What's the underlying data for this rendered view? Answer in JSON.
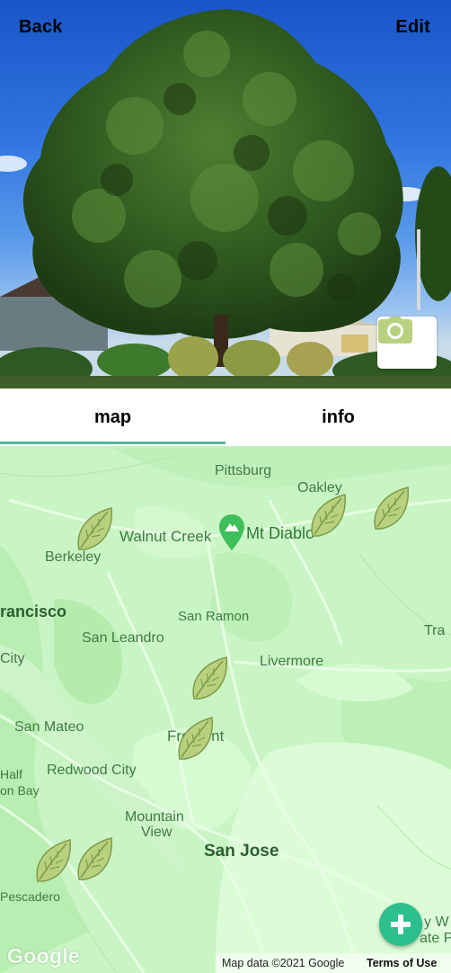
{
  "nav": {
    "back_label": "Back",
    "edit_label": "Edit"
  },
  "tabs": [
    {
      "label": "map",
      "active": true
    },
    {
      "label": "info",
      "active": false
    }
  ],
  "map": {
    "places": {
      "pittsburg": "Pittsburg",
      "oakley": "Oakley",
      "walnut_creek": "Walnut Creek",
      "mt_diablo": "Mt Diablo",
      "berkeley": "Berkeley",
      "francisco": "rancisco",
      "san_ramon": "San Ramon",
      "san_leandro": "San Leandro",
      "tra": "Tra",
      "city": "City",
      "livermore": "Livermore",
      "san_mateo": "San Mateo",
      "fremont": "Fremont",
      "half": "Half",
      "moon_bay": "on Bay",
      "redwood_city": "Redwood City",
      "mountain": "Mountain",
      "view": "View",
      "san_jose": "San Jose",
      "pescadero": "Pescadero",
      "right_edge_1": "y W",
      "right_edge_2": "ate P"
    },
    "tree_pin_count": 7,
    "attribution": {
      "logo": "Google",
      "map_data": "Map data ©2021 Google",
      "terms": "Terms of Use"
    }
  },
  "colors": {
    "accent": "#4fb89a",
    "fab": "#2dbf8c",
    "leaf": "#b7d17f",
    "map_bg": "#c9f5c4"
  },
  "icons": {
    "camera": "camera-icon",
    "add": "plus-icon",
    "tree_pin": "leaf-icon",
    "poi": "mountain-pin-icon"
  }
}
